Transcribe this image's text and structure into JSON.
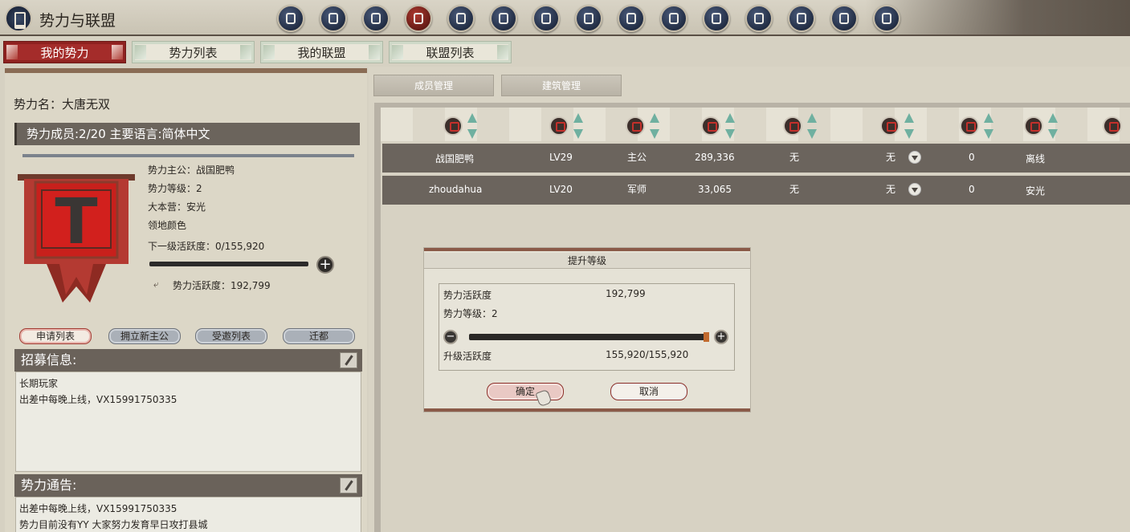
{
  "header": {
    "title": "势力与联盟",
    "nav_icons": [
      "faction-icon",
      "network-icon",
      "helmet-icon",
      "banner-icon",
      "soldier-icon",
      "scroll-icon",
      "target-icon",
      "gear-icon",
      "face-icon",
      "hand-icon",
      "map-icon",
      "writing-icon",
      "book-icon",
      "tablet-icon",
      "ranking-icon"
    ],
    "active_nav_index": 3
  },
  "tabs": [
    {
      "label": "我的势力",
      "active": true
    },
    {
      "label": "势力列表",
      "active": false
    },
    {
      "label": "我的联盟",
      "active": false
    },
    {
      "label": "联盟列表",
      "active": false
    }
  ],
  "faction": {
    "name_line": "势力名：大唐无双",
    "members_line": "势力成员:2/20  主要语言:简体中文",
    "leader": "势力主公：战国肥鸭",
    "level": "势力等级：2",
    "base": "大本营：安光",
    "territory_color": "领地颜色",
    "next_activity": "下一级活跃度：0/155,920",
    "activity_progress": 0,
    "activity": "势力活跃度：192,799",
    "banner_letter": "T"
  },
  "sub_buttons": [
    "申请列表",
    "拥立新主公",
    "受邀列表",
    "迁都"
  ],
  "recruit": {
    "heading": "招募信息:",
    "lines": [
      "长期玩家",
      "出差中每晚上线，VX15991750335"
    ]
  },
  "notice": {
    "heading": "势力通告:",
    "lines": [
      "出差中每晚上线，VX15991750335",
      "势力目前没有YY   大家努力发育早日攻打县城"
    ]
  },
  "management_tabs": [
    "成员管理",
    "建筑管理"
  ],
  "column_icons": [
    "helmet-icon",
    "mask-icon",
    "shield-icon",
    "power-icon",
    "medal-icon",
    "soldiers-icon",
    "sword-icon",
    "gate-icon",
    "soldier-icon"
  ],
  "members": [
    {
      "name": "战国肥鸭",
      "level": "LV29",
      "role": "主公",
      "power": "289,336",
      "c5": "无",
      "c6": "无",
      "c7": "0",
      "status": "离线"
    },
    {
      "name": "zhoudahua",
      "level": "LV20",
      "role": "军师",
      "power": "33,065",
      "c5": "无",
      "c6": "无",
      "c7": "0",
      "status": "安光"
    }
  ],
  "dialog": {
    "title": "提升等级",
    "activity_label": "势力活跃度",
    "activity_value": "192,799",
    "level_line": "势力等级：2",
    "upgrade_label": "升级活跃度",
    "upgrade_value": "155,920/155,920",
    "slider_level": 1.0,
    "confirm": "确定",
    "cancel": "取消"
  },
  "colors": {
    "accent_red": "#a42c2a",
    "header_dark": "#6b645c",
    "sort_arrow": "#6fb0a0"
  }
}
